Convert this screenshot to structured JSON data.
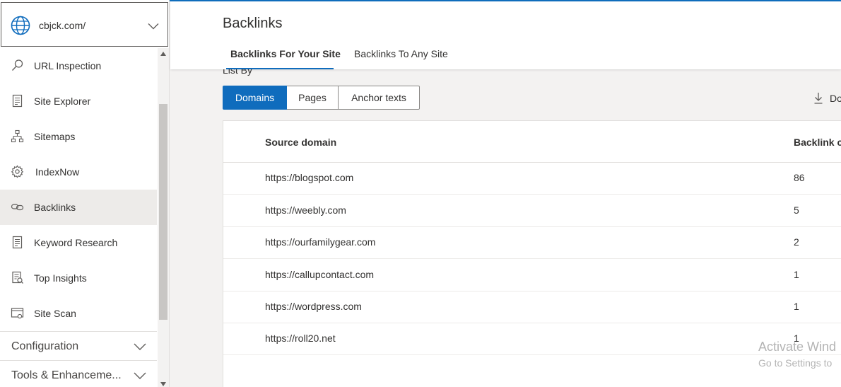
{
  "site": {
    "name": "cbjck.com/",
    "icon": "globe-icon"
  },
  "sidebar": {
    "items": [
      {
        "label": "URL Inspection",
        "icon": "search-icon"
      },
      {
        "label": "Site Explorer",
        "icon": "document-list-icon"
      },
      {
        "label": "Sitemaps",
        "icon": "sitemap-icon"
      },
      {
        "label": "IndexNow",
        "icon": "gear-icon"
      },
      {
        "label": "Backlinks",
        "icon": "link-icon",
        "active": true
      },
      {
        "label": "Keyword Research",
        "icon": "document-list-icon"
      },
      {
        "label": "Top Insights",
        "icon": "insights-icon"
      },
      {
        "label": "Site Scan",
        "icon": "scan-window-icon"
      }
    ],
    "groups": [
      {
        "label": "Configuration"
      },
      {
        "label": "Tools & Enhanceme..."
      }
    ]
  },
  "header": {
    "title": "Backlinks",
    "tabs": [
      {
        "label": "Backlinks For Your Site",
        "active": true
      },
      {
        "label": "Backlinks To Any Site"
      }
    ]
  },
  "main": {
    "list_by_label": "List By",
    "segments": [
      {
        "label": "Domains",
        "selected": true
      },
      {
        "label": "Pages"
      },
      {
        "label": "Anchor texts"
      }
    ],
    "download_label": "Do",
    "table": {
      "columns": [
        "Source domain",
        "Backlink co"
      ],
      "rows": [
        {
          "domain": "https://blogspot.com",
          "count": "86"
        },
        {
          "domain": "https://weebly.com",
          "count": "5"
        },
        {
          "domain": "https://ourfamilygear.com",
          "count": "2"
        },
        {
          "domain": "https://callupcontact.com",
          "count": "1"
        },
        {
          "domain": "https://wordpress.com",
          "count": "1"
        },
        {
          "domain": "https://roll20.net",
          "count": "1"
        }
      ]
    }
  },
  "watermark": {
    "line1": "Activate Wind",
    "line2": "Go to Settings to"
  },
  "colors": {
    "accent": "#0f6cbd",
    "active_nav_bg": "#edebe9",
    "page_bg": "#f3f2f1"
  }
}
